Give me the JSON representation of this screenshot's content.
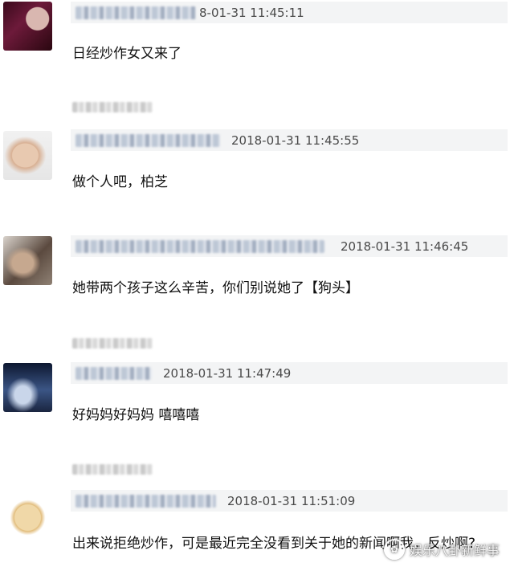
{
  "comments": [
    {
      "timestamp": "8-01-31 11:45:11",
      "text": "日经炒作女又来了",
      "reply_hint": ""
    },
    {
      "timestamp": "2018-01-31 11:45:55",
      "text": "做个人吧，柏芝",
      "reply_hint": ""
    },
    {
      "timestamp": "2018-01-31 11:46:45",
      "text": "她带两个孩子这么辛苦，你们别说她了【狗头】",
      "reply_hint": ""
    },
    {
      "timestamp": "2018-01-31 11:47:49",
      "text": "好妈妈好妈妈 嘻嘻嘻",
      "reply_hint": ""
    },
    {
      "timestamp": "2018-01-31 11:51:09",
      "text": "出来说拒绝炒作，可是最近完全没看到关于她的新闻啊我，反炒啊?",
      "reply_hint": ""
    }
  ],
  "watermark": {
    "icon": "chat-bubble-icon",
    "text": "娱乐八卦新鲜事"
  },
  "colors": {
    "meta_bar": "#f3f4f5",
    "text": "#111111",
    "time": "#4a4a4a"
  }
}
